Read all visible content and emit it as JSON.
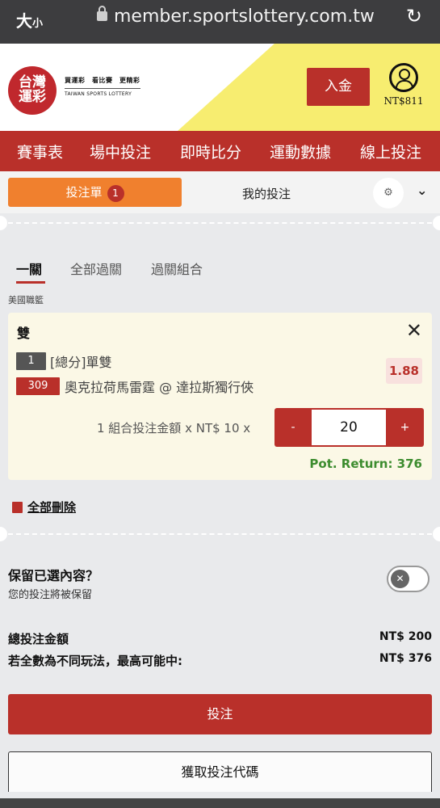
{
  "browser": {
    "text_size_label": "大",
    "text_size_small": "小",
    "url": "member.sportslottery.com.tw"
  },
  "header": {
    "logo_line1": "台灣",
    "logo_line2": "運彩",
    "slogan": "買運彩　看比賽　更精彩",
    "english_name": "TAIWAN SPORTS LOTTERY",
    "deposit_label": "入金",
    "balance": "NT$811"
  },
  "nav": {
    "items": [
      "賽事表",
      "場中投注",
      "即時比分",
      "運動數據",
      "線上投注"
    ]
  },
  "slip_tabs": {
    "betslip_label": "投注單",
    "betslip_count": "1",
    "mybets_label": "我的投注"
  },
  "bet_types": {
    "tabs": [
      "一關",
      "全部過關",
      "過關組合"
    ]
  },
  "league": "美國職籃",
  "bet": {
    "market_title": "雙",
    "selection_code": "1",
    "selection": "[總分]單雙",
    "match_code": "309",
    "match": "奧克拉荷馬雷霆 @ 達拉斯獨行俠",
    "odds": "1.88",
    "stake_label": "1 組合投注金額 x NT$ 10 x",
    "minus": "-",
    "stake": "20",
    "plus": "+",
    "pot_return": "Pot. Return: 376"
  },
  "actions": {
    "delete_all": "全部刪除"
  },
  "keep": {
    "title": "保留已選內容？",
    "subtitle": "您的投注將被保留"
  },
  "summary": {
    "total_label": "總投注金額",
    "total_value": "NT$ 200",
    "max_label": "若全數為不同玩法，最高可能中:",
    "max_value": "NT$ 376"
  },
  "buttons": {
    "place_bet": "投注",
    "get_code": "獲取投注代碼"
  },
  "colors": {
    "brand_red": "#b9302a",
    "orange": "#f0802e",
    "yellow": "#f7ed70",
    "green": "#3c8c2e"
  }
}
